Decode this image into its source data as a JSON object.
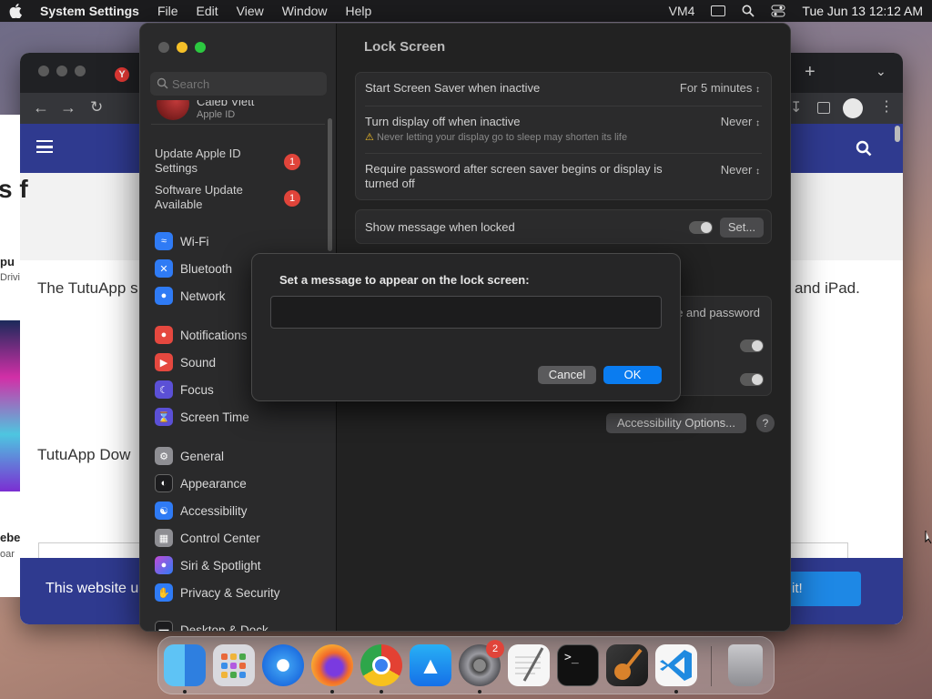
{
  "menubar": {
    "app_name": "System Settings",
    "menus": [
      "File",
      "Edit",
      "View",
      "Window",
      "Help"
    ],
    "status_vm": "VM4",
    "datetime": "Tue Jun 13  12:12 AM"
  },
  "browser": {
    "left_heading_fragment": "s f",
    "para1_left": "The TutuApp s",
    "para1_right": "and iPad.",
    "para2_left": "TutuApp Dow",
    "cookie_text": "This website u",
    "cookie_button": "it!",
    "left_strip": [
      "pu",
      "Drivi",
      "ebe",
      "oar"
    ]
  },
  "sidebar": {
    "search_placeholder": "Search",
    "account_name": "Caleb Viett",
    "account_sub": "Apple ID",
    "alerts": [
      {
        "label": "Update Apple ID Settings",
        "badge": "1"
      },
      {
        "label": "Software Update Available",
        "badge": "1"
      }
    ],
    "items": [
      {
        "label": "Wi-Fi",
        "icon": "wifi-icon",
        "color": "#2f7bf5"
      },
      {
        "label": "Bluetooth",
        "icon": "bluetooth-icon",
        "color": "#2f7bf5"
      },
      {
        "label": "Network",
        "icon": "globe-icon",
        "color": "#2f7bf5"
      },
      {
        "label": "Notifications",
        "icon": "bell-icon",
        "color": "#e5483f"
      },
      {
        "label": "Sound",
        "icon": "speaker-icon",
        "color": "#e5483f"
      },
      {
        "label": "Focus",
        "icon": "moon-icon",
        "color": "#5b50d6"
      },
      {
        "label": "Screen Time",
        "icon": "hourglass-icon",
        "color": "#5b50d6"
      },
      {
        "label": "General",
        "icon": "gear-icon",
        "color": "#8e8e93"
      },
      {
        "label": "Appearance",
        "icon": "appearance-icon",
        "color": "#1c1c1e"
      },
      {
        "label": "Accessibility",
        "icon": "accessibility-icon",
        "color": "#2f7bf5"
      },
      {
        "label": "Control Center",
        "icon": "control-center-icon",
        "color": "#8e8e93"
      },
      {
        "label": "Siri & Spotlight",
        "icon": "siri-icon",
        "color": "#c24bd6"
      },
      {
        "label": "Privacy & Security",
        "icon": "hand-icon",
        "color": "#2f7bf5"
      },
      {
        "label": "Desktop & Dock",
        "icon": "dock-icon",
        "color": "#1c1c1e"
      }
    ]
  },
  "content": {
    "title": "Lock Screen",
    "screensaver_label": "Start Screen Saver when inactive",
    "screensaver_value": "For 5 minutes",
    "display_off_label": "Turn display off when inactive",
    "display_off_warning": "Never letting your display go to sleep may shorten its life",
    "display_off_value": "Never",
    "require_pw_label": "Require password after screen saver begins or display is turned off",
    "require_pw_value": "Never",
    "show_message_label": "Show message when locked",
    "set_button": "Set...",
    "partial_label": "e and password",
    "accessibility_button": "Accessibility Options...",
    "help_button": "?"
  },
  "dialog": {
    "prompt": "Set a message to appear on the lock screen:",
    "input_value": "",
    "cancel": "Cancel",
    "ok": "OK"
  },
  "dock": {
    "apps": [
      "Finder",
      "Launchpad",
      "Safari",
      "Firefox",
      "Chrome",
      "App Store",
      "System Settings",
      "TextEdit",
      "Terminal",
      "GarageBand",
      "VS Code",
      "Trash"
    ],
    "settings_badge": "2"
  },
  "colors": {
    "accent": "#0a7cf0",
    "badge": "#e0443a"
  }
}
